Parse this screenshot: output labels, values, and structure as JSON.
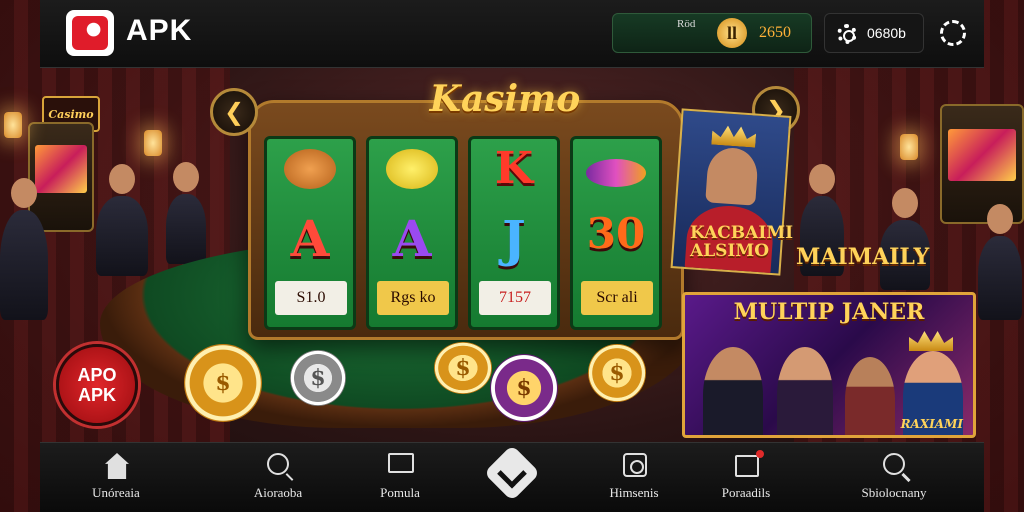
{
  "header": {
    "app_name": "APK",
    "balance_label": "Röd",
    "coin_symbol": "ll",
    "balance_value": "2650",
    "settings_label": "0680b"
  },
  "scene": {
    "wall_sign": "Casimo"
  },
  "game": {
    "title": "Kasimo",
    "arrow_prev": "❮",
    "arrow_next": "❯",
    "reels": [
      {
        "middle_symbol": "A",
        "label": "S1.0"
      },
      {
        "middle_symbol": "A",
        "label": "Rgs ko"
      },
      {
        "middle_symbol": "J",
        "label": "7157"
      },
      {
        "middle_symbol": "30",
        "label": "Scr ali"
      }
    ],
    "reel_top_symbols": [
      "cookie-icon",
      "lemon-icon",
      "letter-k-icon",
      "gem-icon"
    ],
    "reel_k_symbol": "K",
    "chip_symbol": "$"
  },
  "badge": {
    "line1": "APO",
    "line2": "APK"
  },
  "promos": {
    "side_label_line1": "KACBAIMI",
    "side_label_line2": "ALSIMO",
    "side_label_right": "MAIMAILY",
    "card_title": "MULTIP JANER",
    "card_subtitle": "RAXIAMI"
  },
  "bottom_nav": {
    "items": [
      {
        "label": "Unóreaia",
        "icon": "home-icon"
      },
      {
        "label": "Aioraoba",
        "icon": "search-icon"
      },
      {
        "label": "Pomula",
        "icon": "chat-icon"
      },
      {
        "label": "",
        "icon": "chevron-down-icon"
      },
      {
        "label": "Himsenis",
        "icon": "tab-icon"
      },
      {
        "label": "Poraadils",
        "icon": "promotions-icon"
      },
      {
        "label": "Sbiolocnany",
        "icon": "profile-search-icon"
      }
    ]
  },
  "colors": {
    "accent_gold": "#ffd35a",
    "balance_text": "#ffb238",
    "reel_green": "#2da04a",
    "badge_red": "#e0262a"
  }
}
